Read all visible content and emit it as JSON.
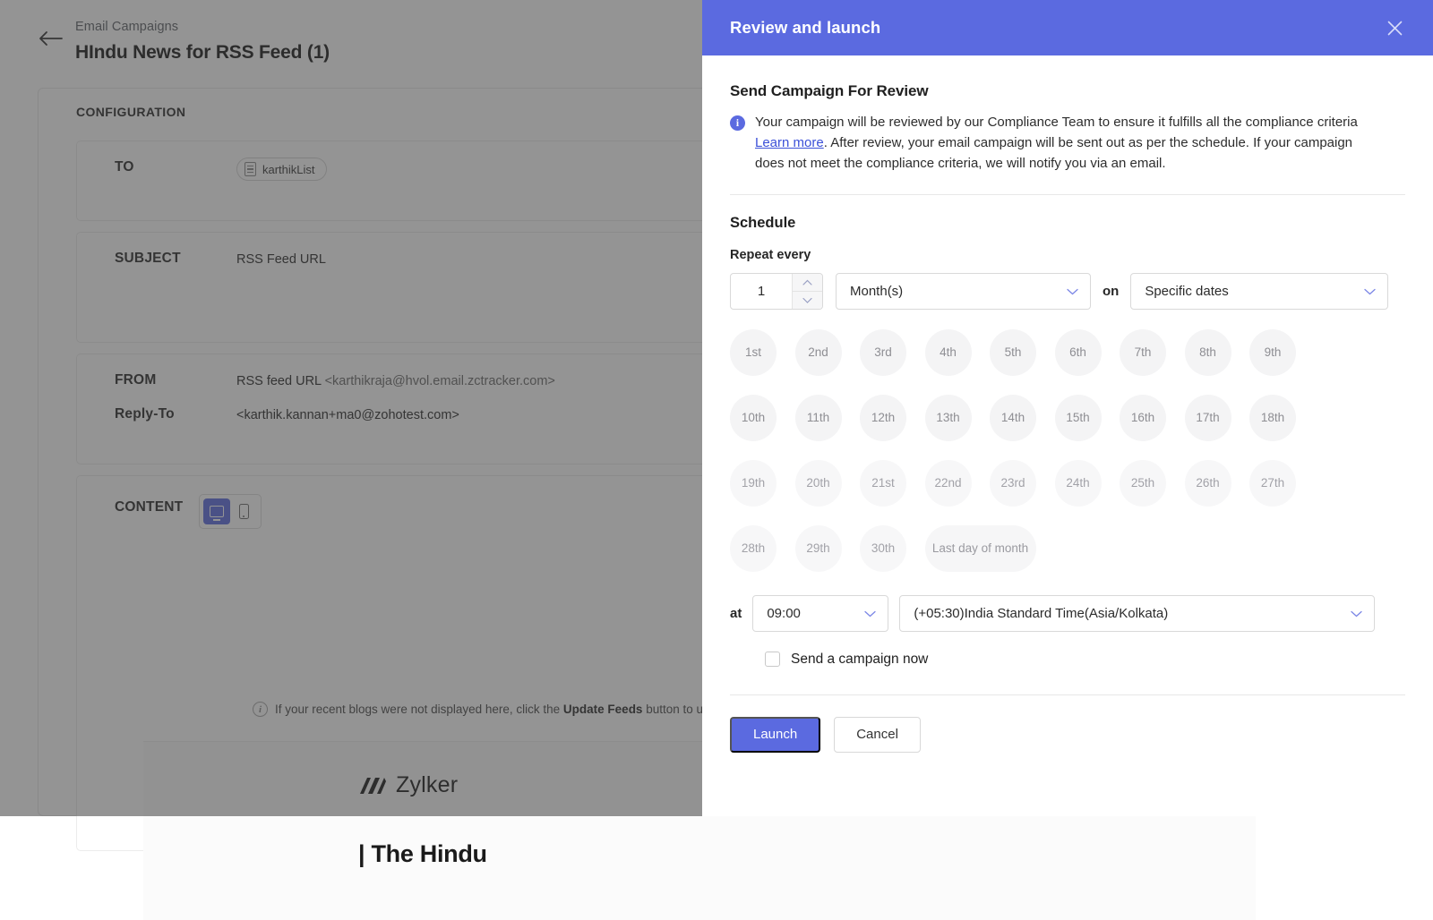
{
  "background": {
    "breadcrumb": "Email Campaigns",
    "page_title": "HIndu News for RSS Feed (1)",
    "back_icon": "arrow-left-icon",
    "config_label": "CONFIGURATION",
    "fields": {
      "to_label": "TO",
      "to_chip": "karthikList",
      "subject_label": "SUBJECT",
      "subject_value": "RSS Feed URL",
      "from_label": "FROM",
      "from_name": "RSS feed URL",
      "from_email": "<karthikraja@hvol.email.zctracker.com>",
      "reply_to_label": "Reply-To",
      "reply_to_value": "<karthik.kannan+ma0@zohotest.com>",
      "content_label": "CONTENT"
    },
    "device_toggle": {
      "desktop_icon": "monitor-icon",
      "mobile_icon": "mobile-icon",
      "active": "desktop"
    },
    "feed_note": {
      "icon": "info-icon",
      "prefix": "If your recent blogs were not displayed here, click the ",
      "strong": "Update Feeds",
      "suffix": " button to update it now."
    },
    "preview": {
      "brand_icon": "zylker-logo-icon",
      "brand": "Zylker",
      "headline": "| The Hindu"
    }
  },
  "modal": {
    "title": "Review and launch",
    "close_icon": "close-icon",
    "section_heading": "Send Campaign For Review",
    "notice": {
      "icon": "info-icon",
      "part1": "Your campaign will be reviewed by our Compliance Team to ensure it fulfills all the compliance criteria ",
      "link": "Learn more",
      "part2": ". After review, your email campaign will be sent out as per the schedule. If your campaign does not meet the compliance criteria, we will notify you via an email."
    },
    "schedule": {
      "heading": "Schedule",
      "repeat_label": "Repeat every",
      "interval_value": "1",
      "stepper_up_icon": "chevron-up-icon",
      "stepper_down_icon": "chevron-down-icon",
      "unit_value": "Month(s)",
      "on_word": "on",
      "mode_value": "Specific dates",
      "dropdown_icon": "chevron-down-icon",
      "dates": [
        "1st",
        "2nd",
        "3rd",
        "4th",
        "5th",
        "6th",
        "7th",
        "8th",
        "9th",
        "10th",
        "11th",
        "12th",
        "13th",
        "14th",
        "15th",
        "16th",
        "17th",
        "18th",
        "19th",
        "20th",
        "21st",
        "22nd",
        "23rd",
        "24th",
        "25th",
        "26th",
        "27th",
        "28th",
        "29th",
        "30th"
      ],
      "last_day_label": "Last day of month",
      "at_word": "at",
      "time_value": "09:00",
      "timezone_value": "(+05:30)India Standard Time(Asia/Kolkata)",
      "send_now_label": "Send a campaign now",
      "send_now_checked": false
    },
    "footer": {
      "launch_label": "Launch",
      "cancel_label": "Cancel"
    }
  },
  "colors": {
    "accent": "#5b6ae0",
    "link": "#3b50d8",
    "pill_bg": "#f4f4f5",
    "overlay": "#3d3d3d"
  }
}
